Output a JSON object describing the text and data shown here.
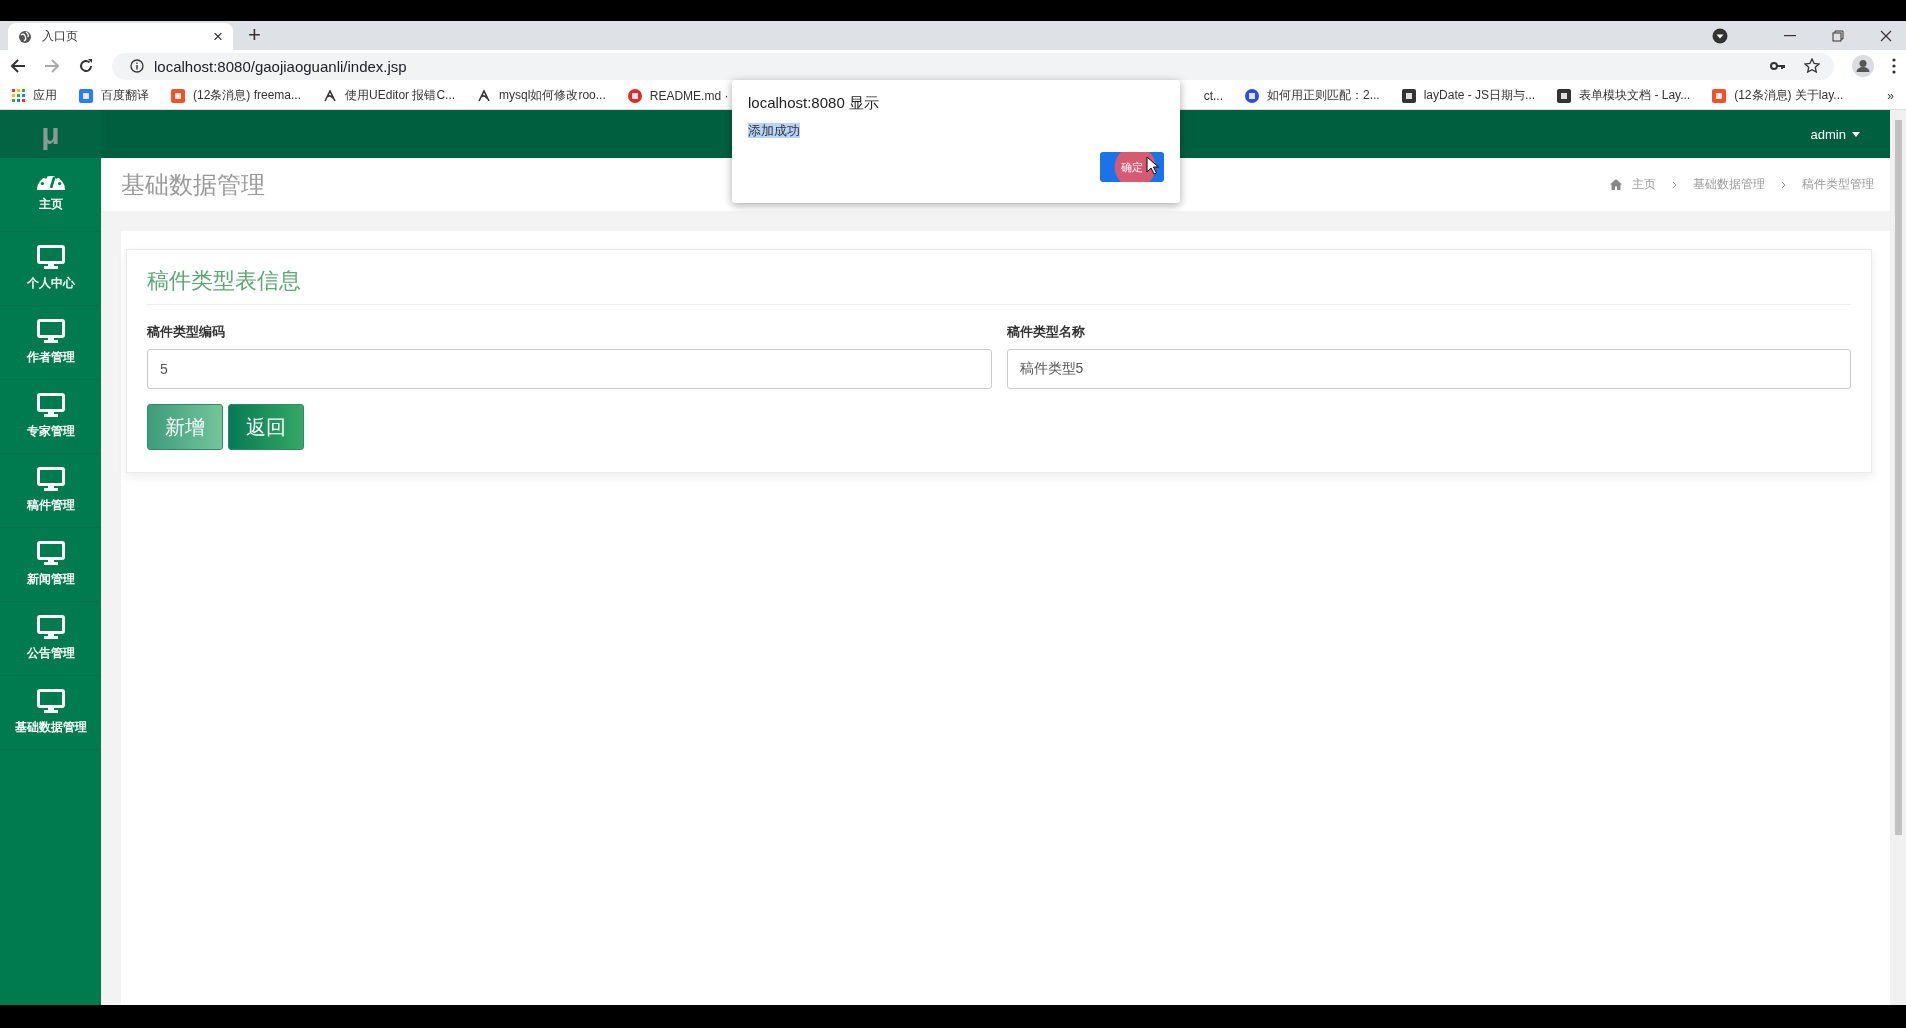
{
  "browser": {
    "tab": {
      "title": "入口页",
      "close": "×"
    },
    "new_tab": "+",
    "address": "localhost:8080/gaojiaoguanli/index.jsp",
    "bookmarks_left": [
      {
        "kind": "apps",
        "label": "应用"
      },
      {
        "kind": "translate",
        "label": "百度翻译"
      },
      {
        "kind": "c",
        "label": "(12条消息) freema..."
      },
      {
        "kind": "ue",
        "label": "使用UEditor 报错C..."
      },
      {
        "kind": "ue",
        "label": "mysql如何修改roo..."
      },
      {
        "kind": "g",
        "label": "README.md ·"
      }
    ],
    "bookmarks_right": [
      {
        "kind": "none",
        "label": "ct..."
      },
      {
        "kind": "paw",
        "label": "如何用正则匹配：2..."
      },
      {
        "kind": "lay",
        "label": "layDate - JS日期与..."
      },
      {
        "kind": "lay",
        "label": "表单模块文档 - Lay..."
      },
      {
        "kind": "c",
        "label": "(12条消息) 关于lay..."
      }
    ],
    "more": "»"
  },
  "app": {
    "logo": "μ",
    "user": "admin",
    "sidebar": [
      {
        "kind": "gauge",
        "label": "主页"
      },
      {
        "kind": "monitor",
        "label": "个人中心"
      },
      {
        "kind": "monitor",
        "label": "作者管理"
      },
      {
        "kind": "monitor",
        "label": "专家管理"
      },
      {
        "kind": "monitor",
        "label": "稿件管理"
      },
      {
        "kind": "monitor",
        "label": "新闻管理"
      },
      {
        "kind": "monitor",
        "label": "公告管理"
      },
      {
        "kind": "monitor",
        "label": "基础数据管理"
      }
    ],
    "page_title": "基础数据管理",
    "breadcrumb": [
      "主页",
      "基础数据管理",
      "稿件类型管理"
    ],
    "card_title": "稿件类型表信息",
    "fields": [
      {
        "label": "稿件类型编码",
        "value": "5"
      },
      {
        "label": "稿件类型名称",
        "value": "稿件类型5"
      }
    ],
    "buttons": [
      {
        "kind": "primary",
        "label": "新增"
      },
      {
        "kind": "secondary",
        "label": "返回"
      }
    ]
  },
  "dialog": {
    "title": "localhost:8080 显示",
    "message": "添加成功",
    "ok": "确定"
  }
}
